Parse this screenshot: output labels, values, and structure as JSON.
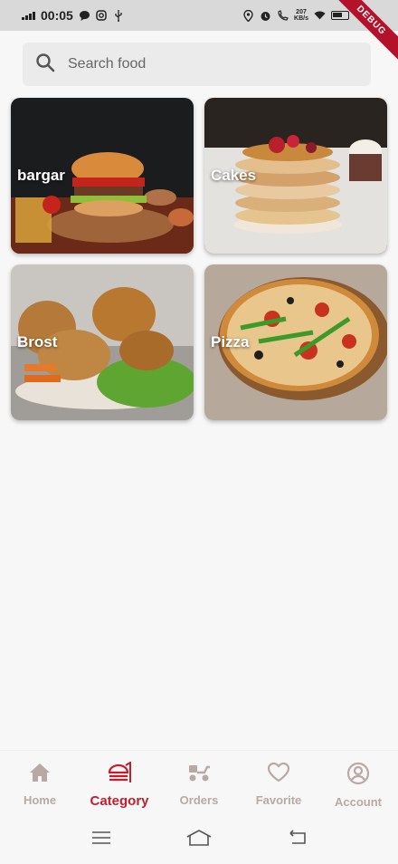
{
  "status_bar": {
    "time": "00:05",
    "net_speed_value": "207",
    "net_speed_unit": "KB/s"
  },
  "debug_banner": "DEBUG",
  "search": {
    "placeholder": "Search food"
  },
  "categories": [
    {
      "label": "bargar"
    },
    {
      "label": "Cakes"
    },
    {
      "label": "Brost"
    },
    {
      "label": "Pizza"
    }
  ],
  "bottom_nav": {
    "items": [
      {
        "label": "Home",
        "icon": "home-icon",
        "active": false
      },
      {
        "label": "Category",
        "icon": "burger-icon",
        "active": true
      },
      {
        "label": "Orders",
        "icon": "scooter-icon",
        "active": false
      },
      {
        "label": "Favorite",
        "icon": "heart-icon",
        "active": false
      },
      {
        "label": "Account",
        "icon": "account-icon",
        "active": false
      }
    ]
  },
  "colors": {
    "accent": "#c21e2e",
    "inactive": "#b8a9a6",
    "background": "#f7f7f7"
  }
}
